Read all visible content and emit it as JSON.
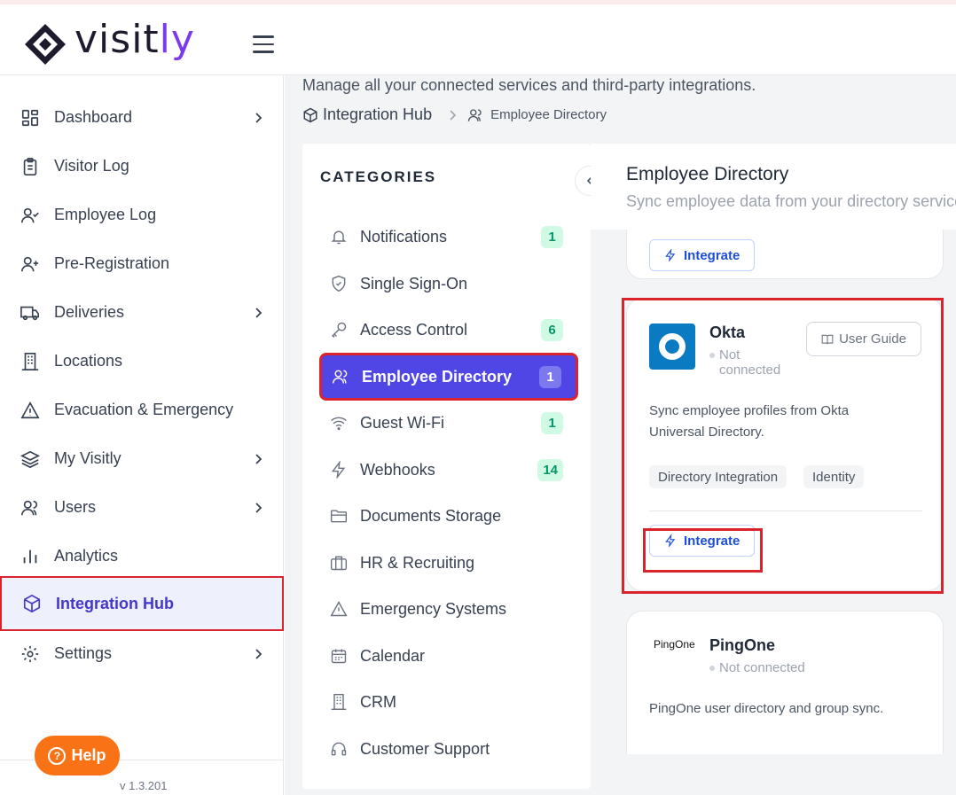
{
  "brand": {
    "name_part1": "visit",
    "name_part2": "ly"
  },
  "sidebar": {
    "items": [
      {
        "label": "Dashboard",
        "icon": "dashboard-icon",
        "chevron": true
      },
      {
        "label": "Visitor Log",
        "icon": "clipboard-icon",
        "chevron": false
      },
      {
        "label": "Employee Log",
        "icon": "user-check-icon",
        "chevron": false
      },
      {
        "label": "Pre-Registration",
        "icon": "user-plus-icon",
        "chevron": false
      },
      {
        "label": "Deliveries",
        "icon": "truck-icon",
        "chevron": true
      },
      {
        "label": "Locations",
        "icon": "building-icon",
        "chevron": false
      },
      {
        "label": "Evacuation & Emergency",
        "icon": "warning-icon",
        "chevron": false
      },
      {
        "label": "My Visitly",
        "icon": "layers-icon",
        "chevron": true
      },
      {
        "label": "Users",
        "icon": "users-icon",
        "chevron": true
      },
      {
        "label": "Analytics",
        "icon": "bar-chart-icon",
        "chevron": false
      },
      {
        "label": "Integration Hub",
        "icon": "cube-icon",
        "chevron": false,
        "active": true
      },
      {
        "label": "Settings",
        "icon": "gear-icon",
        "chevron": true
      }
    ],
    "help_label": "Help",
    "version": "v 1.3.201"
  },
  "page": {
    "subtitle": "Manage all your connected services and third-party integrations.",
    "breadcrumb": {
      "root": "Integration Hub",
      "current": "Employee Directory"
    }
  },
  "categories": {
    "title": "CATEGORIES",
    "items": [
      {
        "label": "Notifications",
        "icon": "bell-icon",
        "badge": "1"
      },
      {
        "label": "Single Sign-On",
        "icon": "shield-icon",
        "badge": ""
      },
      {
        "label": "Access Control",
        "icon": "key-icon",
        "badge": "6"
      },
      {
        "label": "Employee Directory",
        "icon": "users-icon",
        "badge": "1",
        "active": true
      },
      {
        "label": "Guest Wi-Fi",
        "icon": "wifi-icon",
        "badge": "1"
      },
      {
        "label": "Webhooks",
        "icon": "bolt-icon",
        "badge": "14"
      },
      {
        "label": "Documents Storage",
        "icon": "folder-icon",
        "badge": ""
      },
      {
        "label": "HR & Recruiting",
        "icon": "briefcase-icon",
        "badge": ""
      },
      {
        "label": "Emergency Systems",
        "icon": "warning-icon",
        "badge": ""
      },
      {
        "label": "Calendar",
        "icon": "calendar-icon",
        "badge": ""
      },
      {
        "label": "CRM",
        "icon": "building-icon",
        "badge": ""
      },
      {
        "label": "Customer Support",
        "icon": "headset-icon",
        "badge": ""
      }
    ]
  },
  "detail": {
    "title": "Employee Directory",
    "subtitle": "Sync employee data from your directory services"
  },
  "cards": {
    "prev": {
      "integrate_label": "Integrate"
    },
    "okta": {
      "name": "Okta",
      "status_line1": "Not",
      "status_line2": "connected",
      "guide_label": "User Guide",
      "desc_line1": "Sync employee profiles from Okta",
      "desc_line2": "Universal Directory.",
      "tags": [
        "Directory Integration",
        "Identity"
      ],
      "integrate_label": "Integrate"
    },
    "pingone": {
      "logo_text": "PingOne",
      "name": "PingOne",
      "status": "Not connected",
      "desc": "PingOne user directory and group sync."
    }
  },
  "colors": {
    "accent": "#4f46e5",
    "brand_purple": "#7c3aed",
    "highlight": "#d9232d",
    "help": "#f97316",
    "badge_bg": "#d1fae5",
    "badge_text": "#059669"
  }
}
